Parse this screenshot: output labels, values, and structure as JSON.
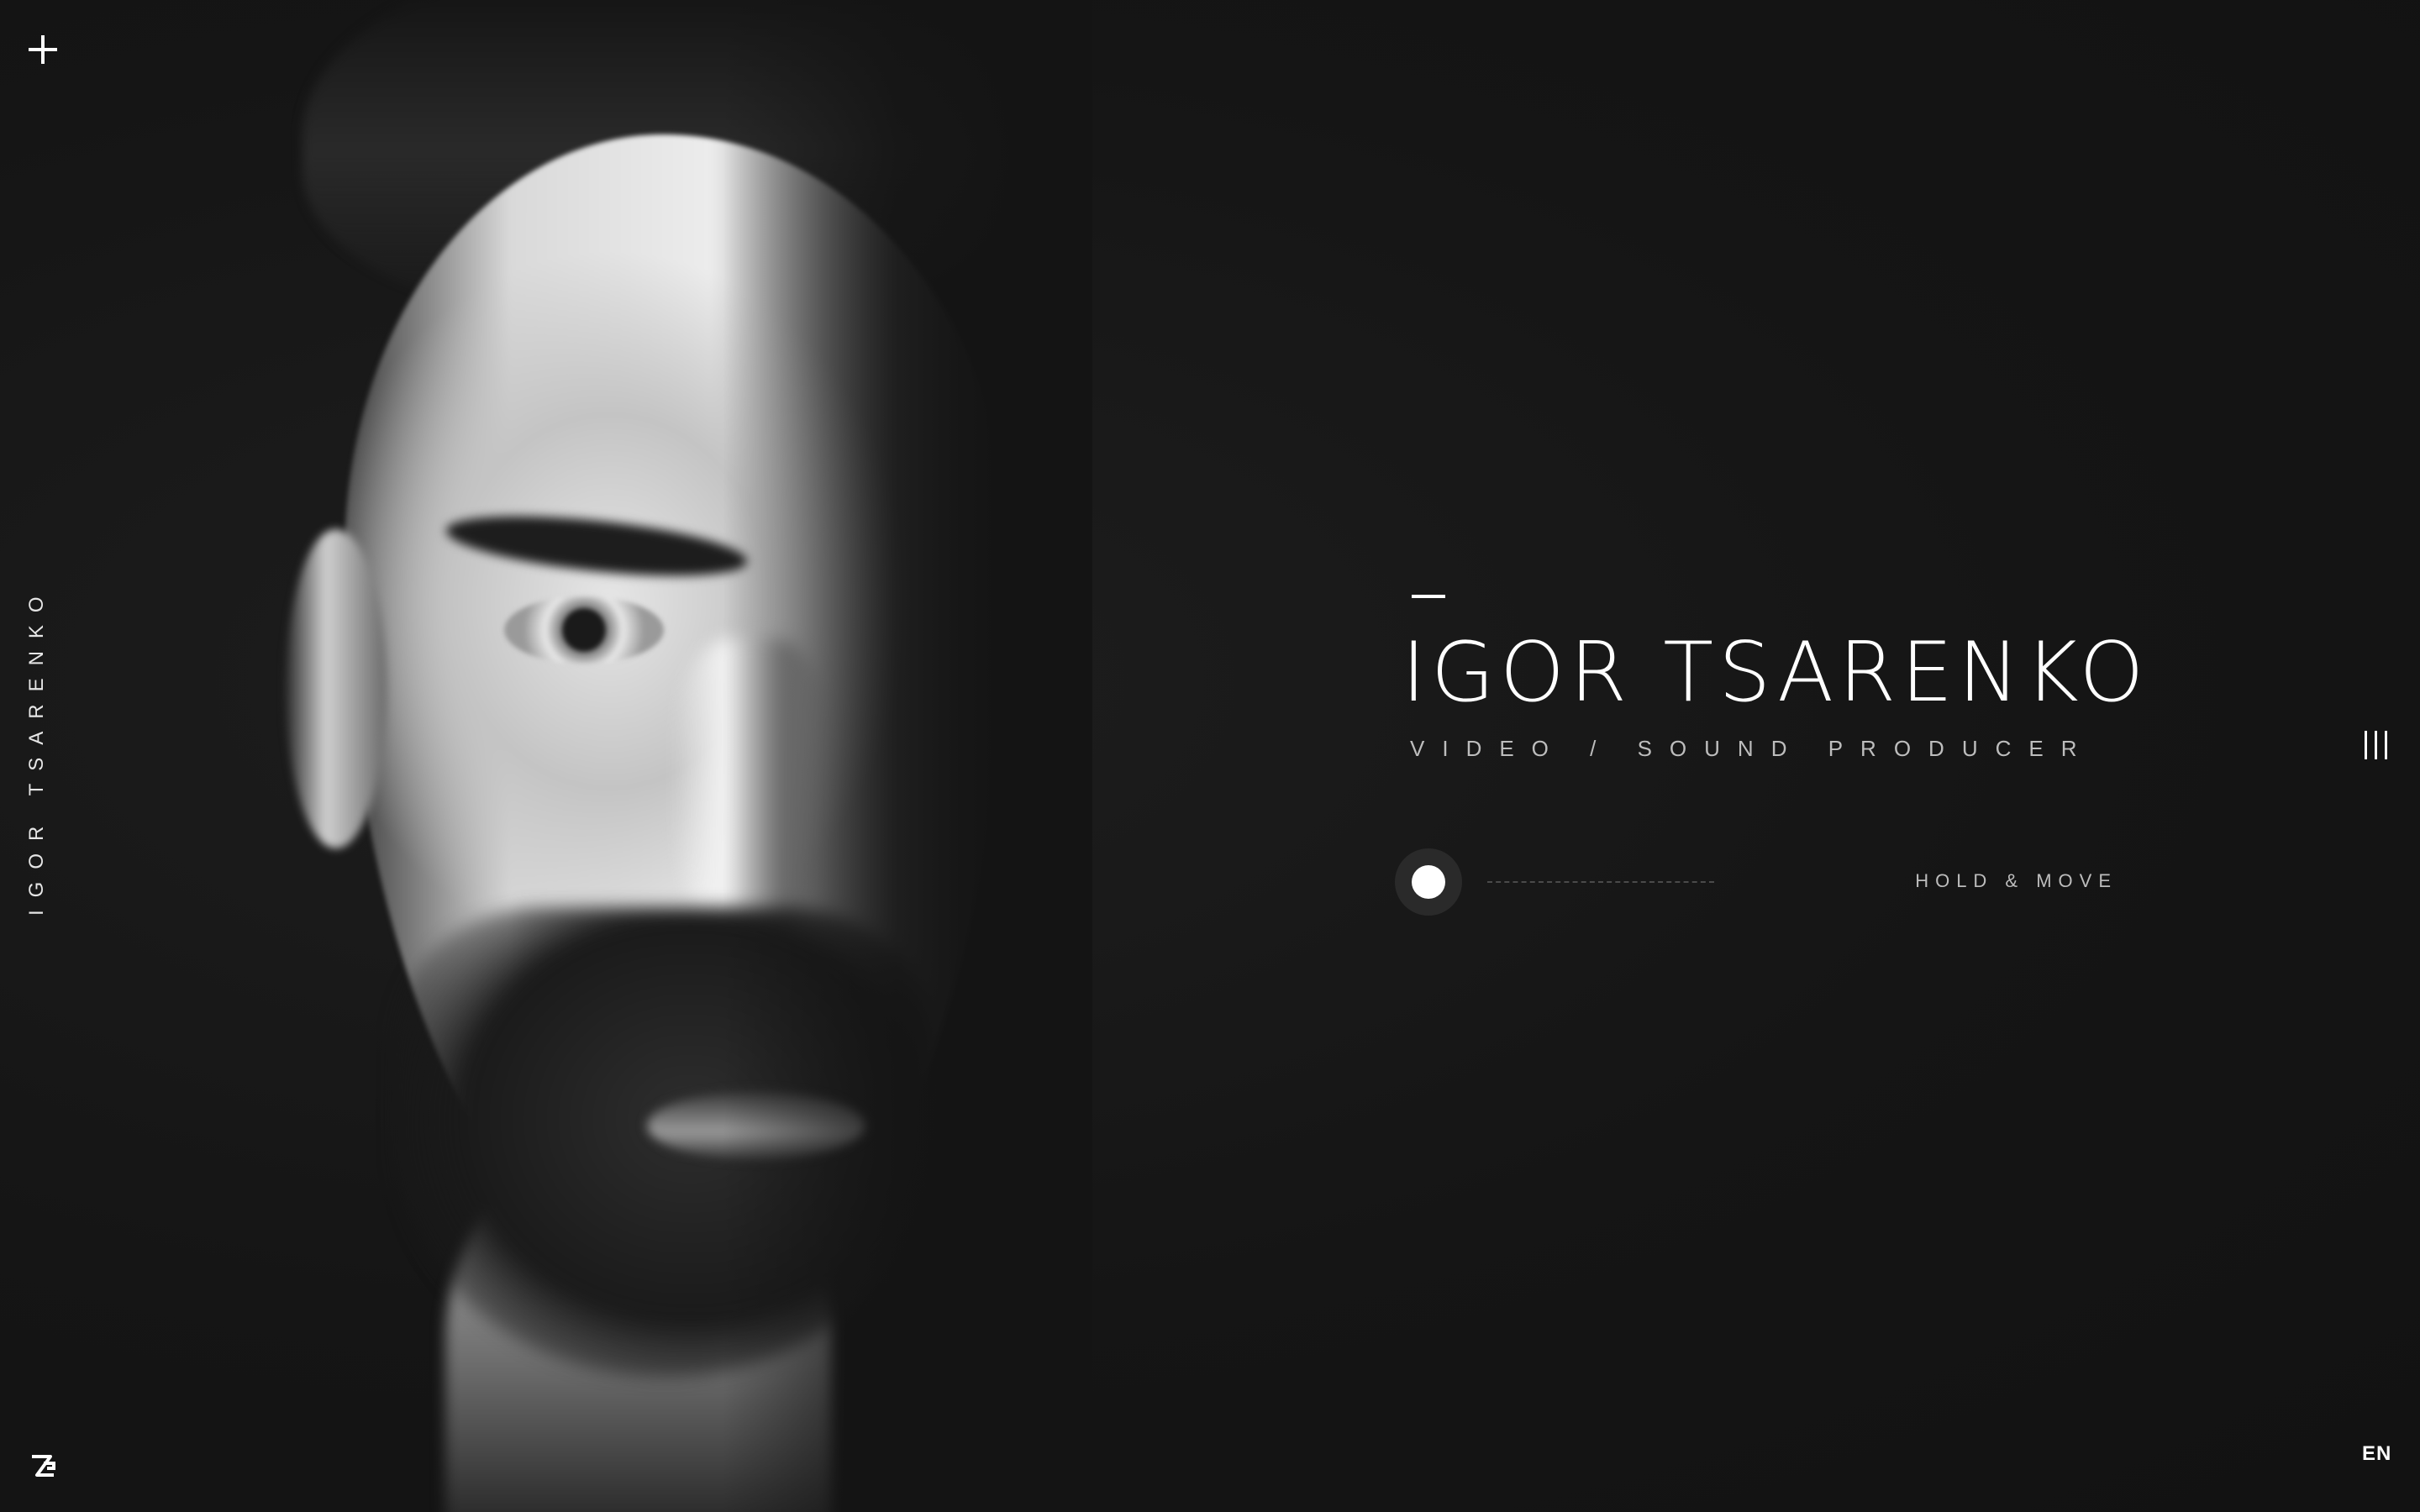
{
  "hero": {
    "title": "IGOR TSARENKO",
    "subtitle": "VIDEO / SOUND PRODUCER"
  },
  "sidebar": {
    "vertical_name": "IGOR TSARENKO"
  },
  "slider": {
    "hint": "HOLD & MOVE",
    "progress": 0
  },
  "language": {
    "current": "EN"
  },
  "icons": {
    "top_left": "plus-icon",
    "bottom_left": "logo-icon",
    "right": "menu-icon"
  },
  "colors": {
    "background": "#171717",
    "text": "#ffffff",
    "muted_text": "#bdbdbd"
  }
}
